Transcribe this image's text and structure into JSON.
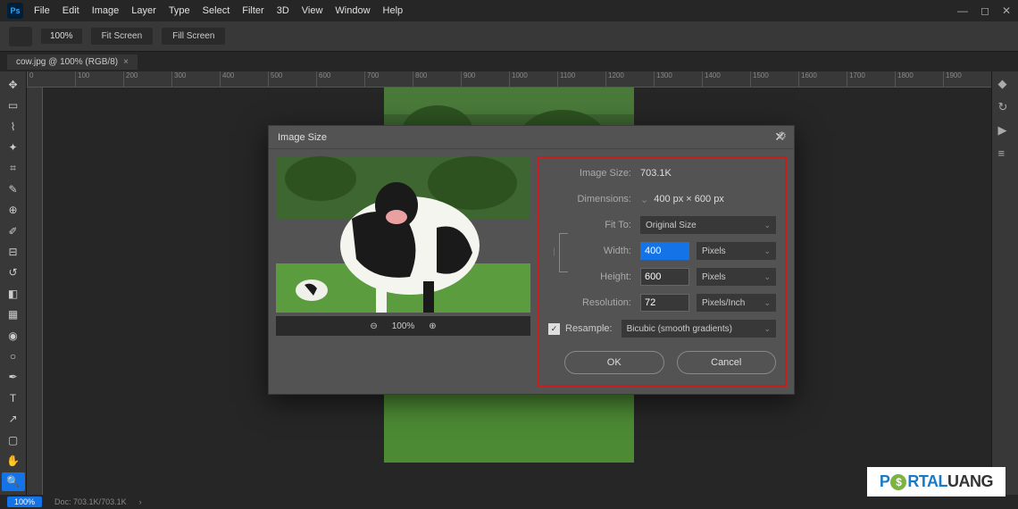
{
  "menu": {
    "items": [
      "File",
      "Edit",
      "Image",
      "Layer",
      "Type",
      "Select",
      "Filter",
      "3D",
      "View",
      "Window",
      "Help"
    ]
  },
  "options": {
    "zoom": "100%",
    "fit_screen": "Fit Screen",
    "fill_screen": "Fill Screen"
  },
  "tab": {
    "title": "cow.jpg @ 100% (RGB/8)"
  },
  "ruler": {
    "ticks": [
      "0",
      "100",
      "200",
      "300",
      "400",
      "500",
      "600",
      "700",
      "800",
      "900",
      "1000",
      "1100",
      "1200",
      "1300",
      "1400",
      "1500",
      "1600",
      "1700",
      "1800",
      "1900"
    ]
  },
  "dialog": {
    "title": "Image Size",
    "image_size_label": "Image Size:",
    "image_size_value": "703.1K",
    "dimensions_label": "Dimensions:",
    "dimensions_value": "400 px × 600 px",
    "fit_to_label": "Fit To:",
    "fit_to_value": "Original Size",
    "width_label": "Width:",
    "width_value": "400",
    "height_label": "Height:",
    "height_value": "600",
    "unit_px": "Pixels",
    "resolution_label": "Resolution:",
    "resolution_value": "72",
    "resolution_unit": "Pixels/Inch",
    "resample_label": "Resample:",
    "resample_value": "Bicubic (smooth gradients)",
    "ok": "OK",
    "cancel": "Cancel",
    "preview_zoom": "100%"
  },
  "status": {
    "zoom": "100%",
    "doc": "Doc: 703.1K/703.1K"
  },
  "watermark": {
    "p": "P",
    "rtal": "RTAL",
    "uang": "UANG"
  }
}
